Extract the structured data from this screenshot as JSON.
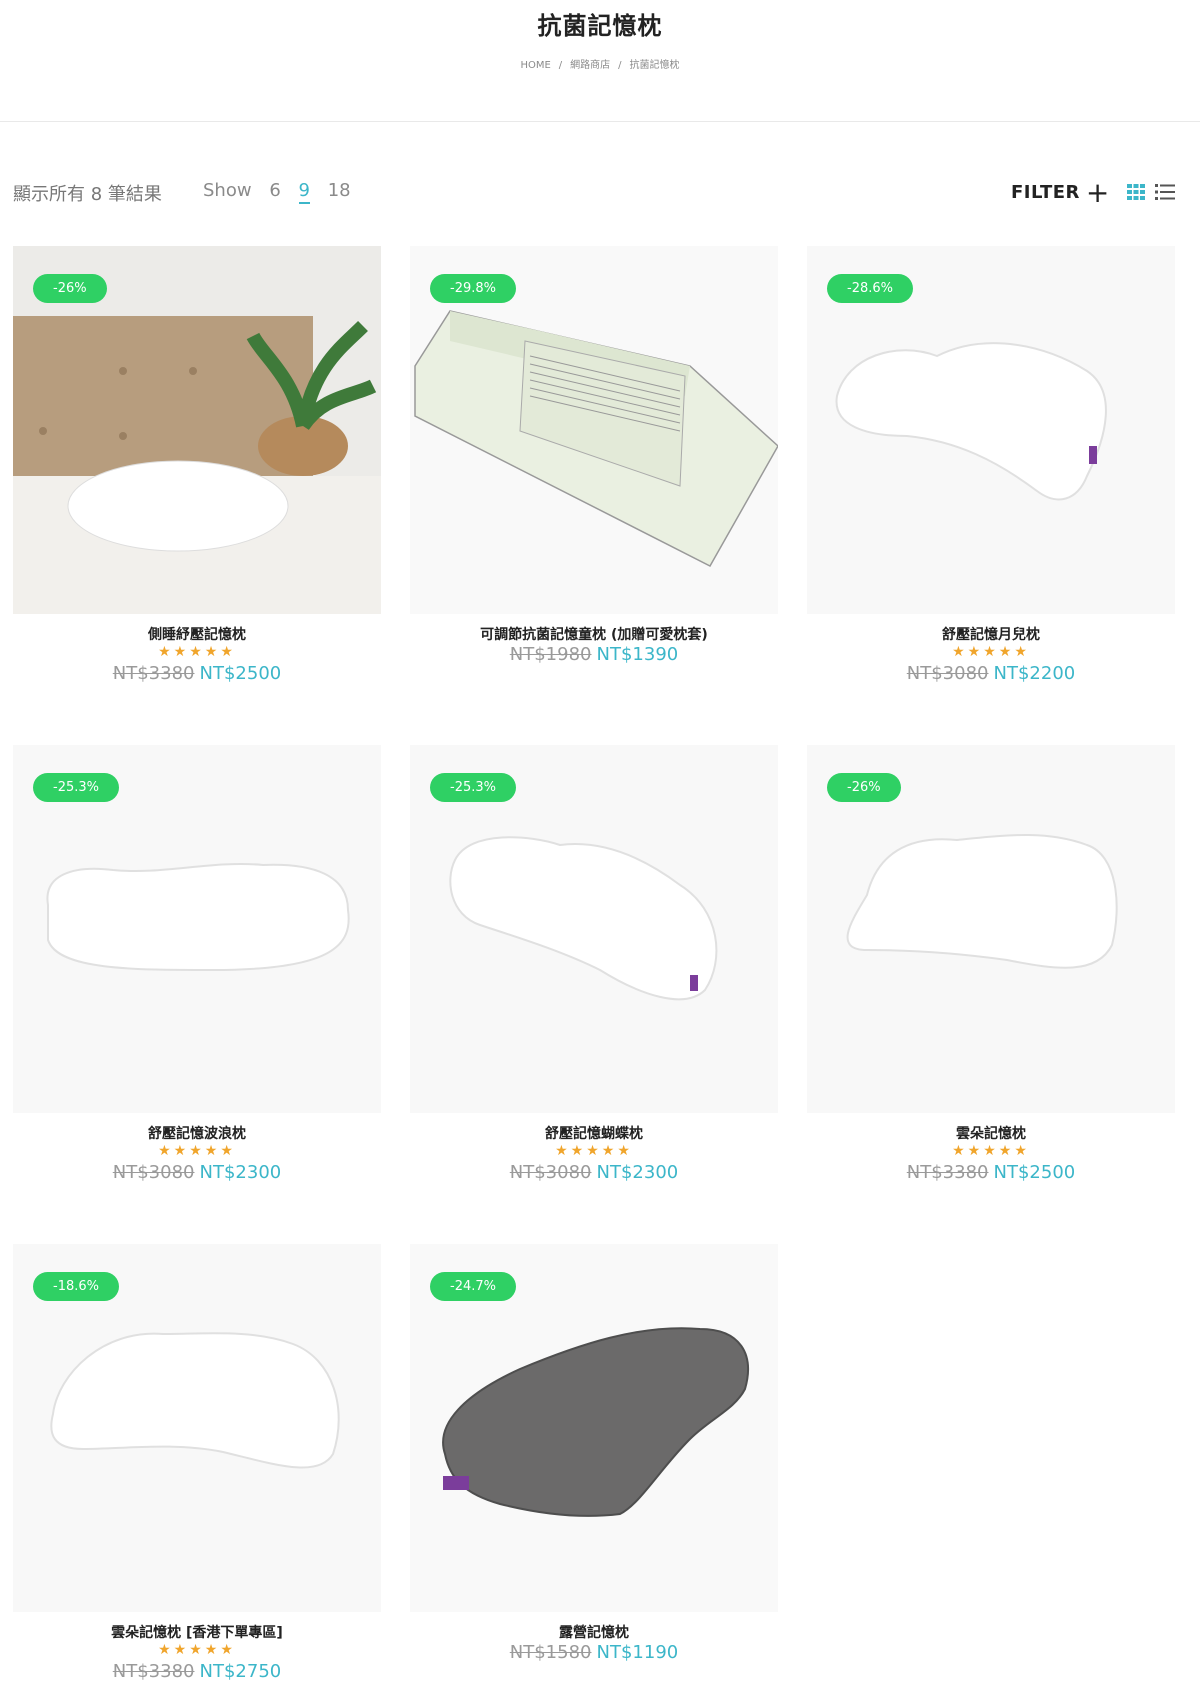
{
  "header": {
    "title": "抗菌記憶枕",
    "breadcrumb": [
      "HOME",
      "網路商店",
      "抗菌記憶枕"
    ]
  },
  "toolbar": {
    "result_count": "顯示所有 8 筆結果",
    "show_label": "Show",
    "show_options": [
      "6",
      "9",
      "18"
    ],
    "show_selected": "9",
    "filter_label": "FILTER",
    "accent_color": "#3cb6c9"
  },
  "products": [
    {
      "badge": "-26%",
      "name": "側睡紓壓記憶枕",
      "stars": "★★★★★",
      "old_price": "NT$3380",
      "new_price": "NT$2500"
    },
    {
      "badge": "-29.8%",
      "name": "可調節抗菌記憶童枕 (加贈可愛枕套)",
      "stars": "",
      "old_price": "NT$1980",
      "new_price": "NT$1390"
    },
    {
      "badge": "-28.6%",
      "name": "舒壓記憶月兒枕",
      "stars": "★★★★★",
      "old_price": "NT$3080",
      "new_price": "NT$2200"
    },
    {
      "badge": "-25.3%",
      "name": "舒壓記憶波浪枕",
      "stars": "★★★★★",
      "old_price": "NT$3080",
      "new_price": "NT$2300"
    },
    {
      "badge": "-25.3%",
      "name": "舒壓記憶蝴蝶枕",
      "stars": "★★★★★",
      "old_price": "NT$3080",
      "new_price": "NT$2300"
    },
    {
      "badge": "-26%",
      "name": "雲朵記憶枕",
      "stars": "★★★★★",
      "old_price": "NT$3380",
      "new_price": "NT$2500"
    },
    {
      "badge": "-18.6%",
      "name": "雲朵記憶枕 [香港下單專區]",
      "stars": "★★★★★",
      "old_price": "NT$3380",
      "new_price": "NT$2750"
    },
    {
      "badge": "-24.7%",
      "name": "露營記憶枕",
      "stars": "",
      "old_price": "NT$1580",
      "new_price": "NT$1190"
    }
  ],
  "colors": {
    "badge": "#2fd064",
    "star": "#f0a52c",
    "price_new": "#3cb6c9",
    "price_old": "#9a9a9a"
  }
}
